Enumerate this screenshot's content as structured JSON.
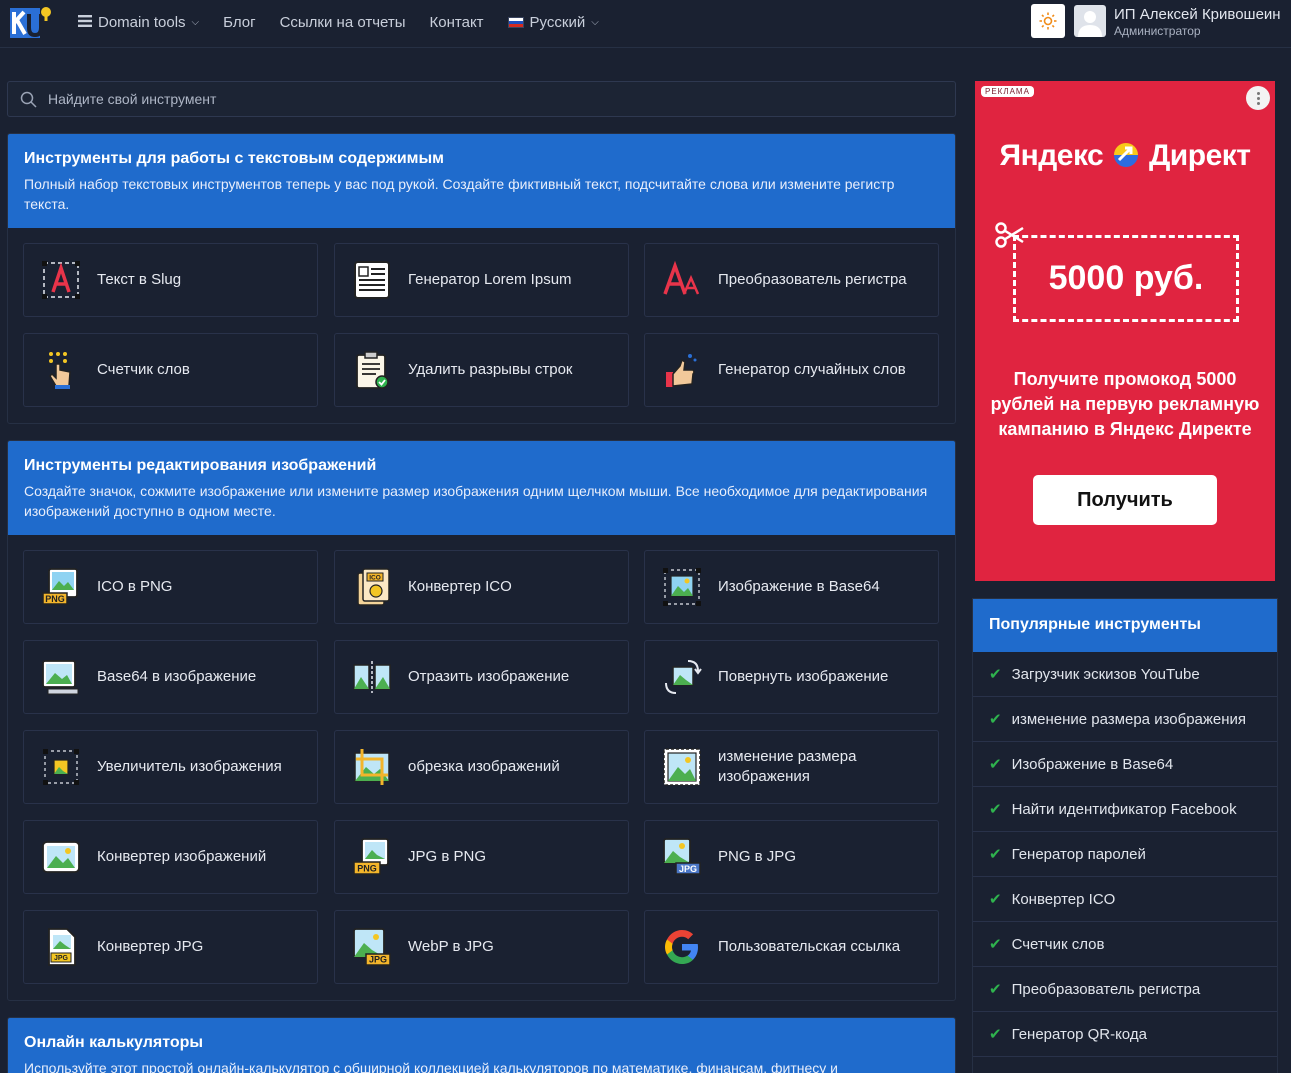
{
  "nav": {
    "domain_tools": "Domain tools",
    "blog": "Блог",
    "reports": "Ссылки на отчеты",
    "contact": "Контакт",
    "language": "Русский"
  },
  "user": {
    "name": "ИП Алексей Кривошеин",
    "role": "Администратор"
  },
  "search": {
    "placeholder": "Найдите свой инструмент"
  },
  "sections": [
    {
      "title": "Инструменты для работы с текстовым содержимым",
      "description": "Полный набор текстовых инструментов теперь у вас под рукой. Создайте фиктивный текст, подсчитайте слова или измените регистр текста.",
      "tools": [
        {
          "label": "Текст в Slug",
          "icon": "slug-icon"
        },
        {
          "label": "Генератор Lorem Ipsum",
          "icon": "lorem-ipsum-icon"
        },
        {
          "label": "Преобразователь регистра",
          "icon": "case-converter-icon"
        },
        {
          "label": "Счетчик слов",
          "icon": "word-counter-icon"
        },
        {
          "label": "Удалить разрывы строк",
          "icon": "remove-line-breaks-icon"
        },
        {
          "label": "Генератор случайных слов",
          "icon": "random-word-icon"
        }
      ]
    },
    {
      "title": "Инструменты редактирования изображений",
      "description": "Создайте значок, сожмите изображение или измените размер изображения одним щелчком мыши. Все необходимое для редактирования изображений доступно в одном месте.",
      "tools": [
        {
          "label": "ICO в PNG",
          "icon": "ico-to-png-icon"
        },
        {
          "label": "Конвертер ICO",
          "icon": "ico-converter-icon"
        },
        {
          "label": "Изображение в Base64",
          "icon": "image-to-base64-icon"
        },
        {
          "label": "Base64 в изображение",
          "icon": "base64-to-image-icon"
        },
        {
          "label": "Отразить изображение",
          "icon": "flip-image-icon"
        },
        {
          "label": "Повернуть изображение",
          "icon": "rotate-image-icon"
        },
        {
          "label": "Увеличитель изображения",
          "icon": "image-enlarger-icon"
        },
        {
          "label": "обрезка изображений",
          "icon": "crop-image-icon"
        },
        {
          "label": "изменение размера изображения",
          "icon": "resize-image-icon"
        },
        {
          "label": "Конвертер изображений",
          "icon": "image-converter-icon"
        },
        {
          "label": "JPG в PNG",
          "icon": "jpg-to-png-icon"
        },
        {
          "label": "PNG в JPG",
          "icon": "png-to-jpg-icon"
        },
        {
          "label": "Конвертер JPG",
          "icon": "jpg-converter-icon"
        },
        {
          "label": "WebP в JPG",
          "icon": "webp-to-jpg-icon"
        },
        {
          "label": "Пользовательская ссылка",
          "icon": "google-icon"
        }
      ]
    },
    {
      "title": "Онлайн калькуляторы",
      "description": "Используйте этот простой онлайн-калькулятор с обширной коллекцией калькуляторов по математике, финансам, фитнесу и"
    }
  ],
  "ad": {
    "tag": "РЕКЛАМА",
    "brand_left": "Яндекс",
    "brand_right": "Директ",
    "amount": "5000 руб.",
    "text": "Получите промокод 5000 рублей на первую рекламную кампанию в Яндекс Директе",
    "button": "Получить",
    "color": "#e02440"
  },
  "popular": {
    "title": "Популярные инструменты",
    "items": [
      "Загрузчик эскизов YouTube",
      "изменение размера изображения",
      "Изображение в Base64",
      "Найти идентификатор Facebook",
      "Генератор паролей",
      "Конвертер ICO",
      "Счетчик слов",
      "Преобразователь регистра",
      "Генератор QR-кода"
    ]
  },
  "colors": {
    "accent": "#1f6bcc",
    "background": "#1a2131",
    "check": "#2fb34e"
  }
}
